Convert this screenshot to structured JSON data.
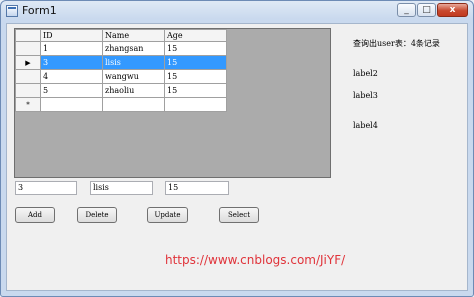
{
  "window": {
    "title": "Form1",
    "min": "_",
    "max": "□",
    "close": "x"
  },
  "grid": {
    "columns": [
      "ID",
      "Name",
      "Age"
    ],
    "row_markers": [
      "",
      "▶",
      "",
      "",
      "*"
    ],
    "rows": [
      [
        "1",
        "zhangsan",
        "15"
      ],
      [
        "3",
        "lisis",
        "15"
      ],
      [
        "4",
        "wangwu",
        "15"
      ],
      [
        "5",
        "zhaoliu",
        "15"
      ],
      [
        "",
        "",
        ""
      ]
    ]
  },
  "info": {
    "count": "查询出user表：4条记录",
    "label2": "label2",
    "label3": "label3",
    "label4": "label4"
  },
  "inputs": {
    "id": "3",
    "name": "lisis",
    "age": "15"
  },
  "buttons": {
    "add": "Add",
    "delete": "Delete",
    "update": "Update",
    "select": "Select"
  },
  "footer": {
    "link": "https://www.cnblogs.com/JiYF/"
  },
  "colors": {
    "selection": "#3399ff",
    "link": "#e0333a",
    "grid_background": "#ababab"
  }
}
